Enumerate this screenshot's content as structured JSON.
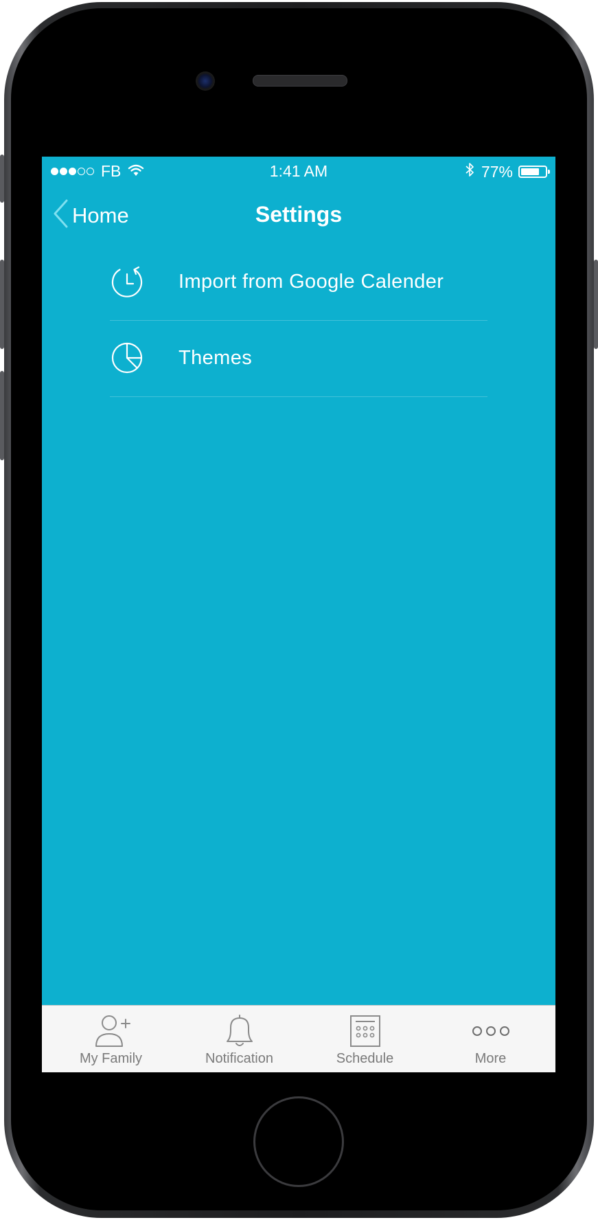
{
  "status_bar": {
    "carrier": "FB",
    "time": "1:41 AM",
    "battery_percent": "77%",
    "battery_level": 0.77,
    "signal_bars": 3
  },
  "nav": {
    "back_label": "Home",
    "title": "Settings"
  },
  "settings": {
    "items": [
      {
        "label": "Import from Google Calender",
        "icon": "history-clock-icon"
      },
      {
        "label": "Themes",
        "icon": "pie-chart-icon"
      }
    ]
  },
  "tabbar": {
    "tabs": [
      {
        "label": "My Family",
        "icon": "add-person-icon"
      },
      {
        "label": "Notification",
        "icon": "bell-icon"
      },
      {
        "label": "Schedule",
        "icon": "calendar-grid-icon"
      },
      {
        "label": "More",
        "icon": "more-dots-icon"
      }
    ]
  },
  "colors": {
    "screen_background": "#0db0cf",
    "tabbar_background": "#f6f6f6",
    "tab_inactive": "#7a7a7a"
  }
}
